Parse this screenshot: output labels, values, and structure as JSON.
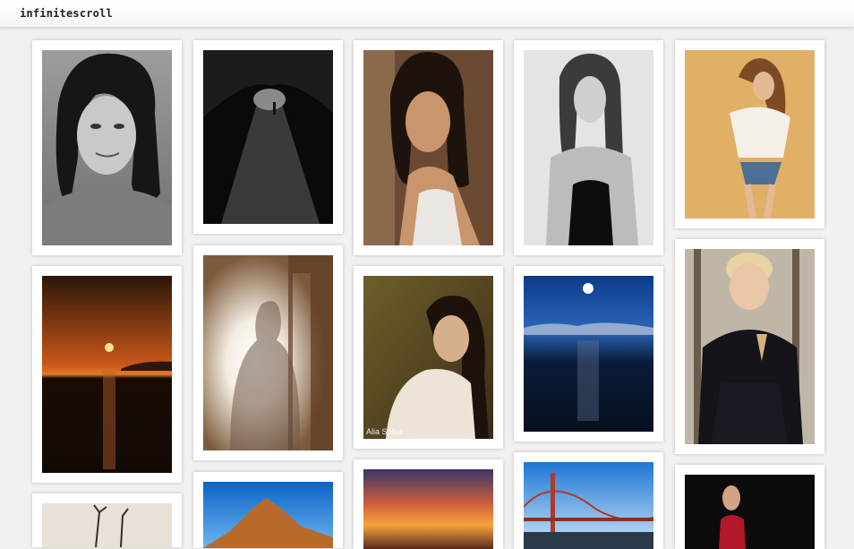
{
  "header": {
    "site_title": "infinitescroll"
  },
  "gallery": {
    "watermarks": {
      "portrait_field": "Alia Sofea"
    }
  }
}
